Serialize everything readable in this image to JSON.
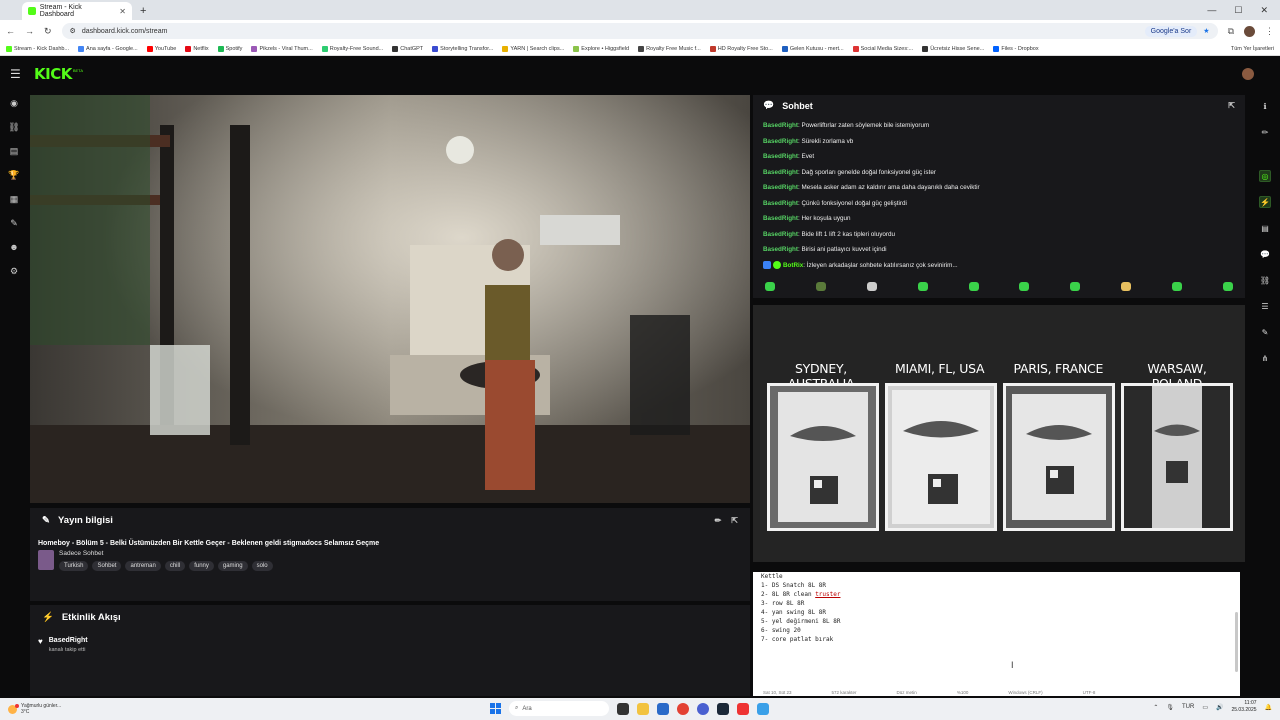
{
  "browser": {
    "tab_title": "Stream - Kick Dashboard",
    "url": "dashboard.kick.com/stream",
    "search_chip": "Google'a Sor",
    "bookmarks": [
      "Stream - Kick Dashb...",
      "Ana sayfa - Google...",
      "YouTube",
      "Netflix",
      "Spotify",
      "Pikzels - Viral Thum...",
      "Royalty-Free Sound...",
      "ChatGPT",
      "Storytelling Transfor...",
      "YARN | Search clips...",
      "Explore • Higgsfield",
      "Royalty Free Music f...",
      "HD Royalty Free Sto...",
      "Gelen Kutusu - mert...",
      "Social Media Sizes:...",
      "Ücretsiz Hisse Sene...",
      "Files - Dropbox"
    ],
    "all_bookmarks": "Tüm Yer İşaretleri"
  },
  "kick": {
    "logo": "KICK",
    "beta": "BETA"
  },
  "stream_info": {
    "heading": "Yayın bilgisi",
    "title": "Homeboy - Bölüm 5 - Belki Üstümüzden Bir Kettle Geçer - Beklenen geldi stigmadocs Selamsız Geçme",
    "category": "Sadece Sohbet",
    "tags": [
      "Turkish",
      "Sohbet",
      "antreman",
      "chill",
      "funny",
      "gaming",
      "solo"
    ]
  },
  "activity": {
    "heading": "Etkinlik Akışı",
    "items": [
      {
        "user": "BasedRight",
        "desc": "kanalı takip etti"
      }
    ]
  },
  "chat": {
    "heading": "Sohbet",
    "messages": [
      {
        "user": "BasedRight",
        "text": ": Powerliftırlar zaten söylemek bile istemiyorum"
      },
      {
        "user": "BasedRight",
        "text": ": Sürekli zorlama vb"
      },
      {
        "user": "BasedRight",
        "text": ": Evet"
      },
      {
        "user": "BasedRight",
        "text": ": Dağ sporları genelde doğal fonksiyonel güç ister"
      },
      {
        "user": "BasedRight",
        "text": ": Mesela asker adam az kaldırır ama daha dayanıklı daha ceviktir"
      },
      {
        "user": "BasedRight",
        "text": ": Çünkü fonksiyonel doğal güç geliştirdi"
      },
      {
        "user": "BasedRight",
        "text": ": Her koşula uygun"
      },
      {
        "user": "BasedRight",
        "text": ": Bide lift 1 lift 2 kas tipleri oluyordu"
      },
      {
        "user": "BasedRight",
        "text": ": Birisi ani patlayıcı kuvvet içindi"
      }
    ],
    "bot_message": {
      "user": "BotRix",
      "text": ": İzleyen arkadaşlar sohbete katılırsanız çok sevinirim..."
    }
  },
  "cicada": {
    "cities": [
      "SYDNEY, AUSTRALIA",
      "MIAMI, FL, USA",
      "PARIS, FRANCE",
      "WARSAW, POLAND"
    ]
  },
  "notepad": {
    "lines": [
      "Kettle",
      "1- DS Snatch 8L 8R",
      "2- 8L 8R clean ",
      "3- row 8L 8R",
      "4- yan swing 8L 8R",
      "5- yel değirmeni 8L 8R",
      "6- swing 20",
      "7- core patlat bırak"
    ],
    "misspelled": "truster",
    "status": [
      "Sat 10, Süt 23",
      "572 karakter",
      "Düz metin",
      "%100",
      "Windows (CRLF)",
      "UTF-8"
    ]
  },
  "taskbar": {
    "weather_title": "Yağmurlu günler...",
    "weather_temp": "3°C",
    "search_placeholder": "Ara",
    "lang": "TUR",
    "time": "11:07",
    "date": "25.03.2025"
  }
}
